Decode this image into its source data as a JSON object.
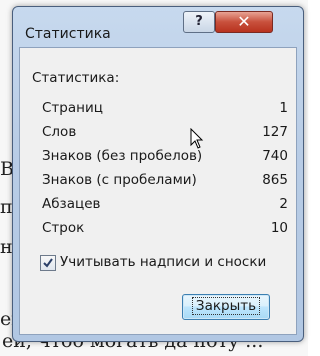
{
  "dialog": {
    "title": "Статистика",
    "help_label": "?",
    "close_glyph": "✕",
    "group_label": "Статистика:",
    "stats": [
      {
        "label": "Страниц",
        "value": "1"
      },
      {
        "label": "Слов",
        "value": "127"
      },
      {
        "label": "Знаков (без пробелов)",
        "value": "740"
      },
      {
        "label": "Знаков (с пробелами)",
        "value": "865"
      },
      {
        "label": "Абзацев",
        "value": "2"
      },
      {
        "label": "Строк",
        "value": "10"
      }
    ],
    "checkbox_label": "Учитывать надписи и сноски",
    "checkbox_checked": true,
    "close_button_label": "Закрыть"
  },
  "background": {
    "fragments": [
      "Вс",
      "п",
      "н",
      "ег"
    ],
    "bottom_line": "ей, чтоб могать да ноту ..."
  },
  "colors": {
    "close_button_red": "#c8503c",
    "default_button_blue": "#bee6fd"
  },
  "icons": {
    "help": "question-mark-icon",
    "close": "close-icon",
    "check": "checkmark-icon",
    "cursor": "mouse-pointer-icon"
  }
}
